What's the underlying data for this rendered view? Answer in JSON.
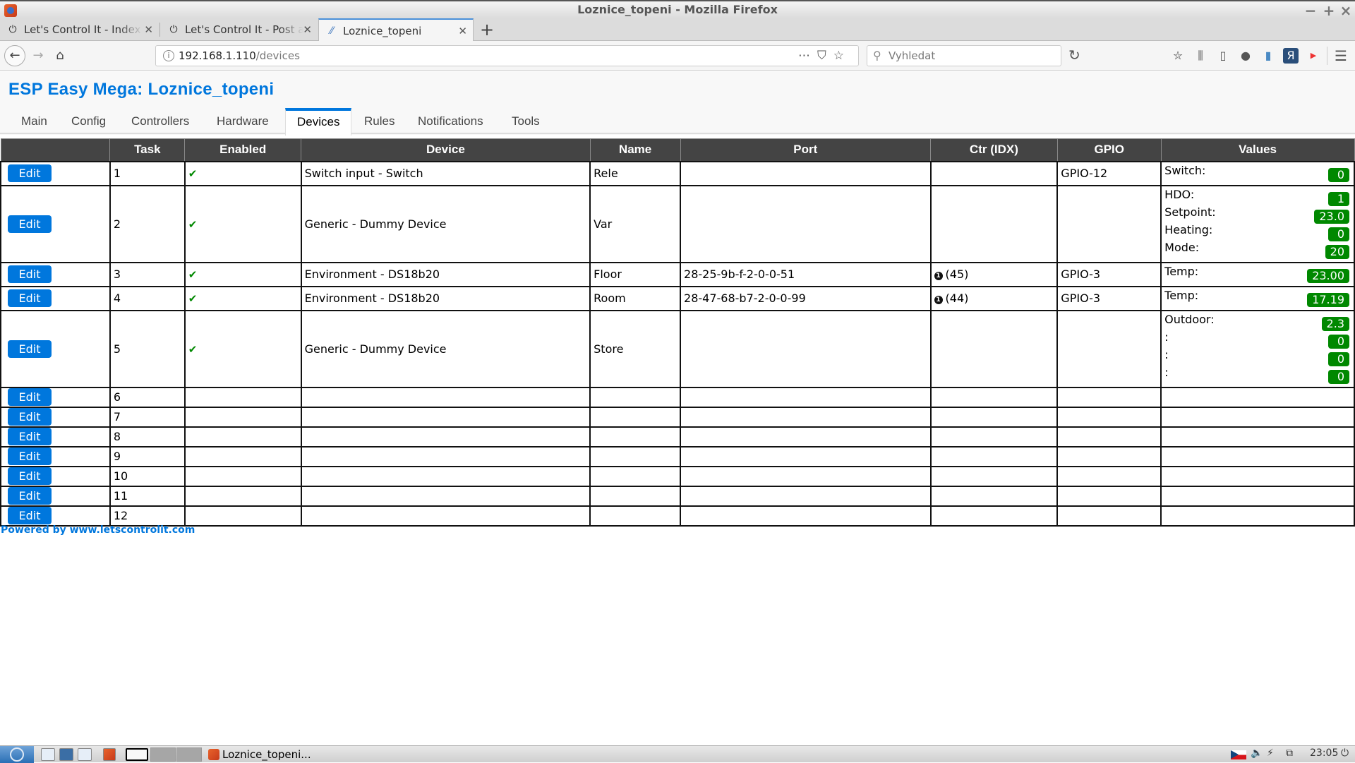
{
  "window": {
    "title": "Loznice_topeni - Mozilla Firefox",
    "controls": {
      "minimize": "−",
      "maximize": "+",
      "close": "×"
    }
  },
  "tabs": [
    {
      "label": "Let's Control It - Index page",
      "icon": "power-icon",
      "active": false
    },
    {
      "label": "Let's Control It - Post a reply",
      "icon": "power-icon",
      "active": false
    },
    {
      "label": "Loznice_topeni",
      "icon": "esp-icon",
      "active": true
    }
  ],
  "navbar": {
    "url_host": "192.168.1.110",
    "url_path": "/devices",
    "search_placeholder": "Vyhledat"
  },
  "page": {
    "title": "ESP Easy Mega: Loznice_topeni",
    "menu": [
      {
        "label": "Main",
        "active": false
      },
      {
        "label": "Config",
        "active": false
      },
      {
        "label": "Controllers",
        "active": false
      },
      {
        "label": "Hardware",
        "active": false
      },
      {
        "label": "Devices",
        "active": true
      },
      {
        "label": "Rules",
        "active": false
      },
      {
        "label": "Notifications",
        "active": false
      },
      {
        "label": "Tools",
        "active": false
      }
    ],
    "table": {
      "headers": [
        "",
        "Task",
        "Enabled",
        "Device",
        "Name",
        "Port",
        "Ctr (IDX)",
        "GPIO",
        "Values"
      ],
      "edit_label": "Edit",
      "rows": [
        {
          "task": "1",
          "enabled": "✔",
          "device": "Switch input - Switch",
          "name": "Rele",
          "port": "",
          "ctr": "",
          "gpio": "GPIO-12",
          "values": [
            {
              "label": "Switch:",
              "value": "0"
            }
          ]
        },
        {
          "task": "2",
          "enabled": "✔",
          "device": "Generic - Dummy Device",
          "name": "Var",
          "port": "",
          "ctr": "",
          "gpio": "",
          "values": [
            {
              "label": "HDO:",
              "value": "1"
            },
            {
              "label": "Setpoint:",
              "value": "23.0"
            },
            {
              "label": "Heating:",
              "value": "0"
            },
            {
              "label": "Mode:",
              "value": "20"
            }
          ]
        },
        {
          "task": "3",
          "enabled": "✔",
          "device": "Environment - DS18b20",
          "name": "Floor",
          "port": "28-25-9b-f-2-0-0-51",
          "ctr": "(45)",
          "ctr_num": "1",
          "gpio": "GPIO-3",
          "values": [
            {
              "label": "Temp:",
              "value": "23.00"
            }
          ]
        },
        {
          "task": "4",
          "enabled": "✔",
          "device": "Environment - DS18b20",
          "name": "Room",
          "port": "28-47-68-b7-2-0-0-99",
          "ctr": "(44)",
          "ctr_num": "1",
          "gpio": "GPIO-3",
          "values": [
            {
              "label": "Temp:",
              "value": "17.19"
            }
          ]
        },
        {
          "task": "5",
          "enabled": "✔",
          "device": "Generic - Dummy Device",
          "name": "Store",
          "port": "",
          "ctr": "",
          "gpio": "",
          "values": [
            {
              "label": "Outdoor:",
              "value": "2.3"
            },
            {
              "label": ":",
              "value": "0"
            },
            {
              "label": ":",
              "value": "0"
            },
            {
              "label": ":",
              "value": "0"
            }
          ]
        },
        {
          "task": "6"
        },
        {
          "task": "7"
        },
        {
          "task": "8"
        },
        {
          "task": "9"
        },
        {
          "task": "10"
        },
        {
          "task": "11"
        },
        {
          "task": "12"
        }
      ]
    },
    "footer": "Powered by www.letscontrolit.com"
  },
  "taskbar": {
    "task_label": "Loznice_topeni...",
    "clock": "23:05"
  },
  "colors": {
    "accent": "#0077dd",
    "value_badge": "#008800",
    "table_header": "#444444"
  }
}
